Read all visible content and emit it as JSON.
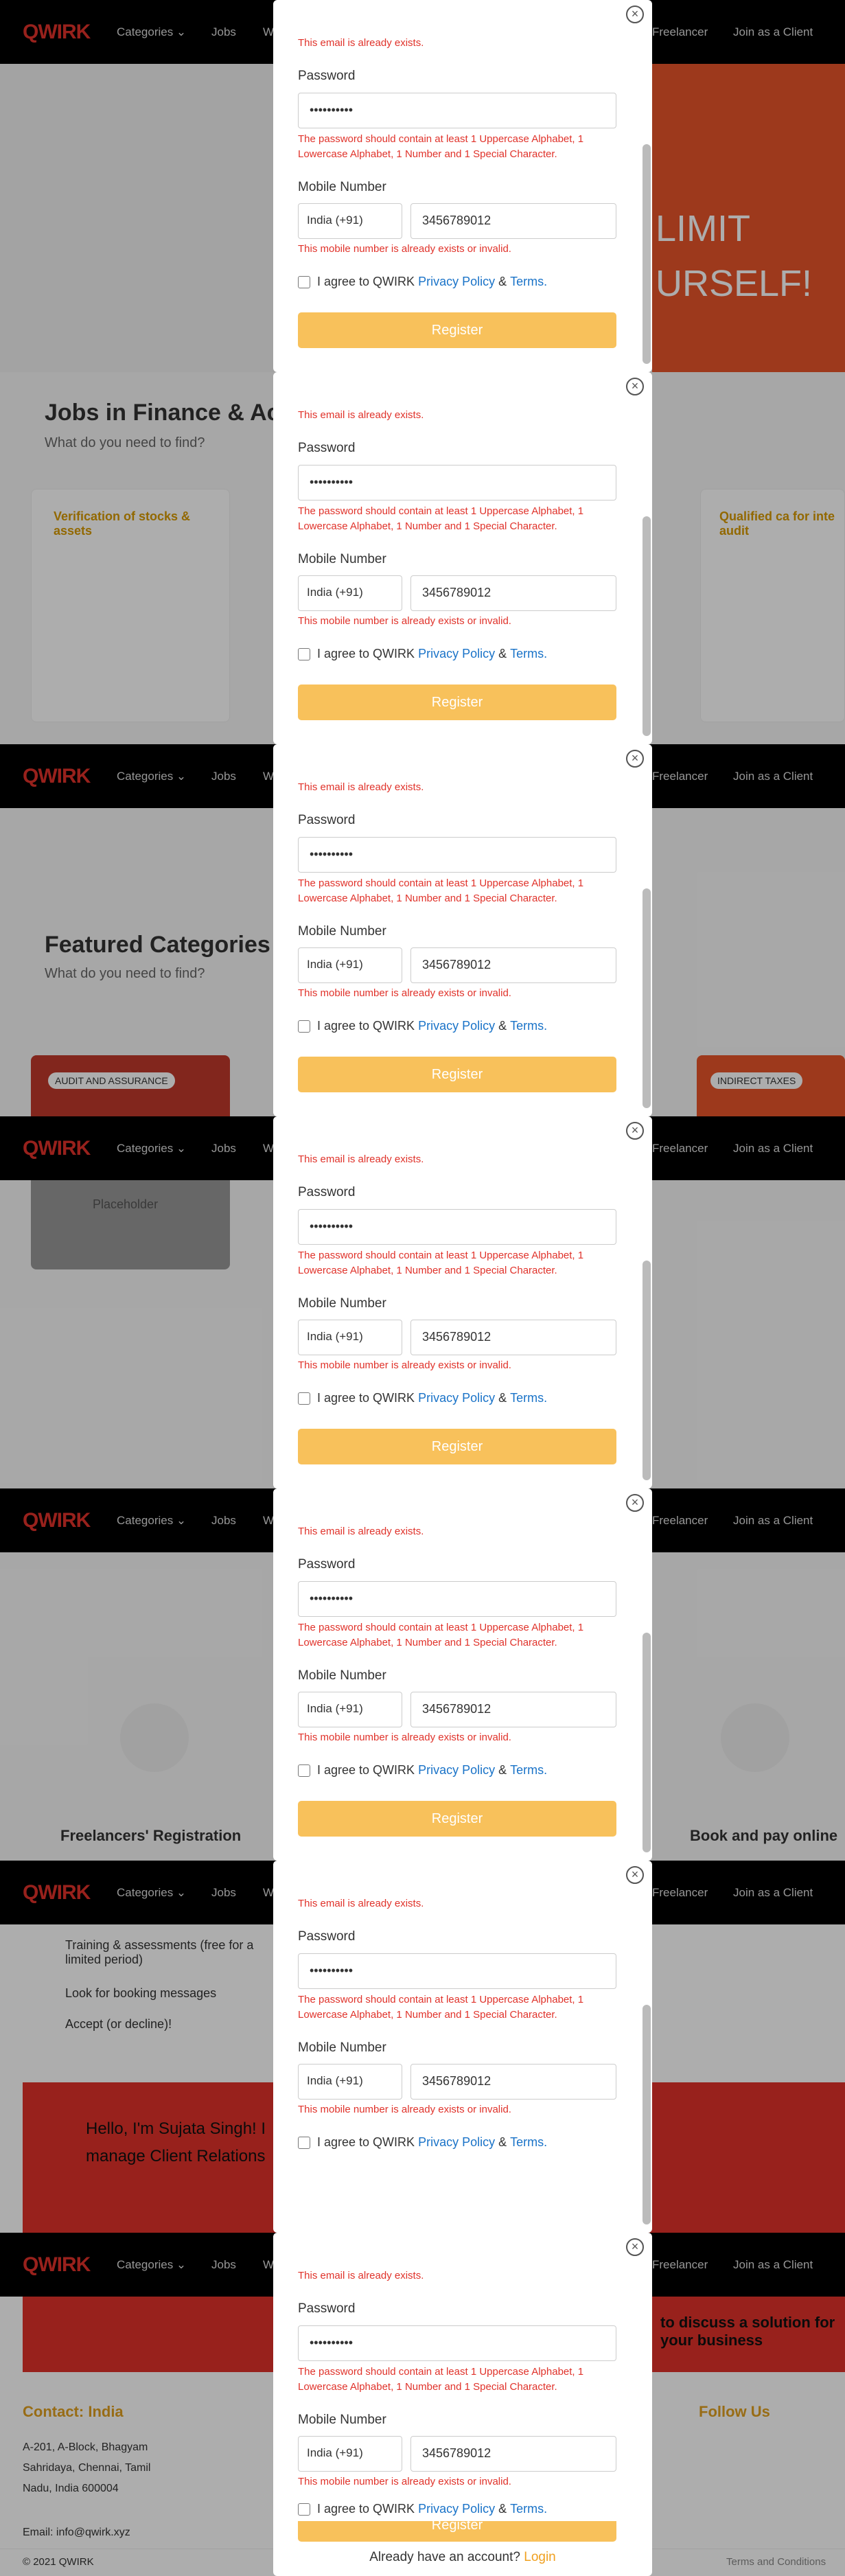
{
  "nav": {
    "logo": "QWIRK",
    "categories": "Categories ⌄",
    "jobs": "Jobs",
    "w": "W",
    "freelancer": "Freelancer",
    "client": "Join as a Client"
  },
  "modal": {
    "email_error": "This email is already exists.",
    "password_label": "Password",
    "password_value": "••••••••••",
    "password_error": "The password should contain at least 1 Uppercase Alphabet, 1 Lowercase Alphabet, 1 Number and 1 Special Character.",
    "mobile_label": "Mobile Number",
    "country": "India (+91)",
    "phone": "3456789012",
    "mobile_error": "This mobile number is already exists or invalid.",
    "agree_prefix": "I agree to QWIRK",
    "privacy": "Privacy Policy",
    "amp": "&",
    "terms": "Terms.",
    "register": "Register",
    "already": "Already have an account?",
    "login": "Login"
  },
  "bg": {
    "s1": "LIMIT URSELF!",
    "s2_title": "Jobs in Finance & Ac",
    "s2_sub": "What do you need to find?",
    "s2_card1": "Verification of stocks & assets",
    "s2_card2": "Qualified ca for inte audit",
    "s3_title": "Featured Categories",
    "s3_sub": "What do you need to find?",
    "s3_tag1": "AUDIT AND ASSURANCE",
    "s3_tag2": "INDIRECT TAXES",
    "s4_text": "Placeholder",
    "s5_left": "Freelancers' Registration",
    "s5_right": "Book and pay online",
    "s6_item1": "Training & assessments (free for a limited period)",
    "s6_item2": "Look for booking messages",
    "s6_item3": "Accept (or decline)!",
    "s6_banner": "Hello, I'm Sujata Singh! I manage Client Relations",
    "s7_contact": "Contact: India",
    "s7_addr": "A-201, A-Block, Bhagyam Sahridaya, Chennai, Tamil Nadu, India 600004",
    "s7_email": "Email: info@qwirk.xyz",
    "s7_follow": "Follow Us",
    "s7_copy": "© 2021 QWIRK",
    "s7_terms": "Terms and Conditions",
    "s7_cta": "to discuss a solution for your business"
  }
}
